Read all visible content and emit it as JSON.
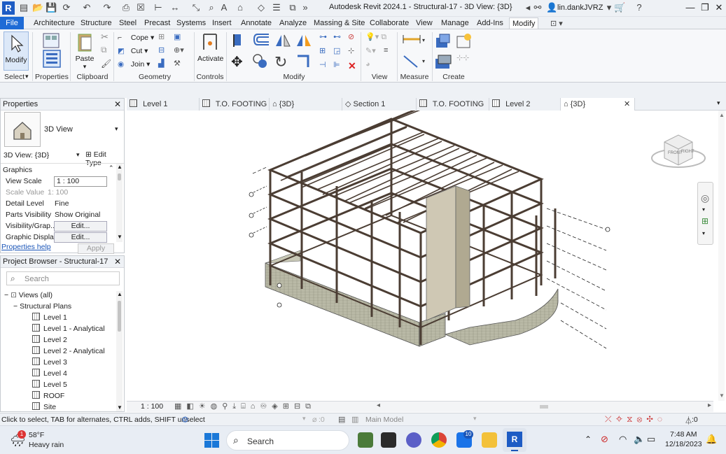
{
  "app": {
    "title": "Autodesk Revit 2024.1 - Structural-17 - 3D View: {3D}",
    "user": "lin.dankJVRZ",
    "logo_letter": "R"
  },
  "menu": {
    "tabs": [
      "File",
      "Architecture",
      "Structure",
      "Steel",
      "Precast",
      "Systems",
      "Insert",
      "Annotate",
      "Analyze",
      "Massing & Site",
      "Collaborate",
      "View",
      "Manage",
      "Add-Ins",
      "Modify"
    ],
    "active": "Modify"
  },
  "ribbon": {
    "modify_btn": "Modify",
    "panels": {
      "select": "Select",
      "properties": "Properties",
      "clipboard": "Clipboard",
      "geometry": "Geometry",
      "controls": "Controls",
      "modify": "Modify",
      "view": "View",
      "measure": "Measure",
      "create": "Create"
    },
    "paste": "Paste",
    "cope": "Cope",
    "cut": "Cut",
    "join": "Join",
    "activate": "Activate"
  },
  "properties_panel": {
    "header": "Properties",
    "type_name": "3D View",
    "instance_selector": "3D View: {3D}",
    "edit_type": "Edit Type",
    "section": "Graphics",
    "rows": [
      {
        "key": "View Scale",
        "value": "1 : 100"
      },
      {
        "key": "Scale Value",
        "value": "1:  100"
      },
      {
        "key": "Detail Level",
        "value": "Fine"
      },
      {
        "key": "Parts Visibility",
        "value": "Show Original"
      },
      {
        "key": "Visibility/Grap...",
        "value": "Edit..."
      },
      {
        "key": "Graphic Displa...",
        "value": "Edit..."
      }
    ],
    "help_link": "Properties help",
    "apply": "Apply"
  },
  "project_browser": {
    "header": "Project Browser - Structural-17",
    "search_placeholder": "Search",
    "views_root": "Views (all)",
    "group": "Structural Plans",
    "items": [
      "Level 1",
      "Level 1 - Analytical",
      "Level 2",
      "Level 2 - Analytical",
      "Level 3",
      "Level 4",
      "Level 5",
      "ROOF",
      "Site"
    ]
  },
  "doc_tabs": [
    {
      "label": "Level 1"
    },
    {
      "label": "T.O. FOOTING"
    },
    {
      "label": "{3D}"
    },
    {
      "label": "Section 1"
    },
    {
      "label": "T.O. FOOTING"
    },
    {
      "label": "Level 2"
    },
    {
      "label": "{3D}",
      "active": true
    }
  ],
  "view_controls": {
    "scale": "1 : 100"
  },
  "status": {
    "hint": "Click to select, TAB for alternates, CTRL adds, SHIFT unselect",
    "workset_count": ":0",
    "model": "Main Model",
    "filter_count": ":0"
  },
  "taskbar": {
    "weather_temp": "58°F",
    "weather_desc": "Heavy rain",
    "weather_badge": "1",
    "search": "Search",
    "mail_badge": "10",
    "time": "7:48 AM",
    "date": "12/18/2023"
  },
  "colors": {
    "accent": "#1e6bd6",
    "steel": "#5a4a3e",
    "concrete": "#b9b9a6"
  }
}
